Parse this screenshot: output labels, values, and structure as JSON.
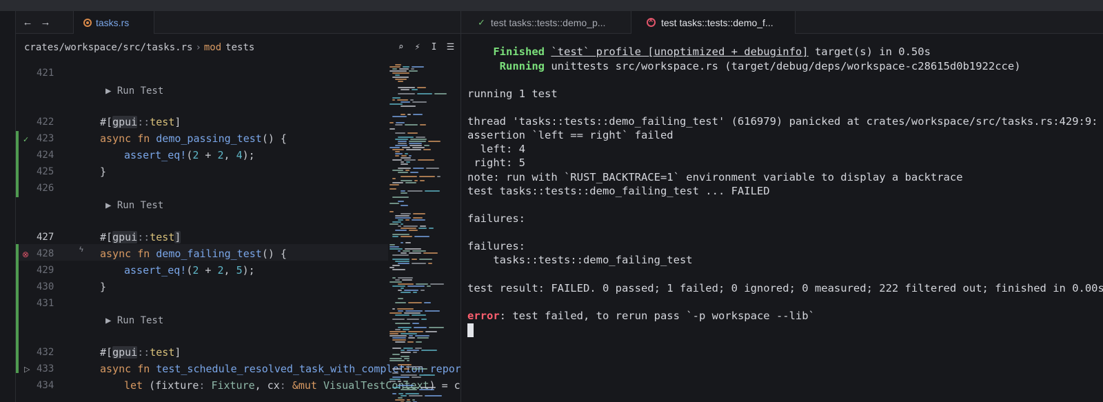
{
  "editor": {
    "active_tab": "tasks.rs",
    "breadcrumb": {
      "path": "crates/workspace/src/tasks.rs",
      "separator": "›",
      "mod_keyword": "mod",
      "mod_name": "tests"
    },
    "lines": [
      {
        "n": "421"
      },
      {
        "run": "▶ Run Test"
      },
      {
        "n": "422",
        "attr_hash": "#",
        "attr_lb": "[",
        "attr_ns": "gpui",
        "attr_sep": "::",
        "attr_name": "test",
        "attr_rb": "]"
      },
      {
        "n": "423",
        "kw1": "async",
        "kw2": "fn",
        "fn": "demo_passing_test",
        "rest": "() {"
      },
      {
        "n": "424",
        "mac": "assert_eq!",
        "args_open": "(",
        "a": "2",
        "op": " + ",
        "b": "2",
        "comma": ", ",
        "c": "4",
        "args_close": ");"
      },
      {
        "n": "425",
        "brace": "}"
      },
      {
        "n": "426"
      },
      {
        "run": "▶ Run Test"
      },
      {
        "n": "427",
        "attr_hash": "#",
        "attr_lb": "[",
        "attr_ns": "gpui",
        "attr_sep": "::",
        "attr_name": "test",
        "attr_rb": "]"
      },
      {
        "n": "428",
        "kw1": "async",
        "kw2": "fn",
        "fn": "demo_failing_test",
        "rest": "() {"
      },
      {
        "n": "429",
        "mac": "assert_eq!",
        "args_open": "(",
        "a": "2",
        "op": " + ",
        "b": "2",
        "comma": ", ",
        "c": "5",
        "args_close": ");"
      },
      {
        "n": "430",
        "brace": "}"
      },
      {
        "n": "431"
      },
      {
        "run": "▶ Run Test"
      },
      {
        "n": "432",
        "attr_hash": "#",
        "attr_lb": "[",
        "attr_ns": "gpui",
        "attr_sep": "::",
        "attr_name": "test",
        "attr_rb": "]"
      },
      {
        "n": "433",
        "kw1": "async",
        "kw2": "fn",
        "fn": "test_schedule_resolved_task_with_completion_report"
      },
      {
        "n": "434",
        "let_kw": "let",
        "let_open": " (fixture",
        "colon1": ": ",
        "ty1": "Fixture",
        "comma1": ", cx",
        "colon2": ": ",
        "ref": "&mut ",
        "ty2": "VisualTestContext",
        "tail": ") = cr"
      }
    ]
  },
  "terminal": {
    "tabs": [
      {
        "label": "test tasks::tests::demo_p...",
        "status": "passed"
      },
      {
        "label": "test tasks::tests::demo_f...",
        "status": "failed"
      }
    ],
    "output": {
      "finished_word": "Finished",
      "finished_profile": "`test` profile [unoptimized + debuginfo]",
      "finished_rest": " target(s) in 0.50s",
      "running_word": "Running",
      "running_rest": " unittests src/workspace.rs (target/debug/deps/workspace-c28615d0b1922cce)",
      "running_tests": "running 1 test",
      "panic": "thread 'tasks::tests::demo_failing_test' (616979) panicked at crates/workspace/src/tasks.rs:429:9:",
      "assertion": "assertion `left == right` failed",
      "left": "  left: 4",
      "right": " right: 5",
      "note": "note: run with `RUST_BACKTRACE=1` environment variable to display a backtrace",
      "test_failed": "test tasks::tests::demo_failing_test ... FAILED",
      "failures1": "failures:",
      "failures2": "failures:",
      "failure_name": "    tasks::tests::demo_failing_test",
      "result": "test result: FAILED. 0 passed; 1 failed; 0 ignored; 0 measured; 222 filtered out; finished in 0.00s",
      "error_word": "error",
      "error_rest": ": test failed, to rerun pass `-p workspace --lib`"
    }
  },
  "colors": {
    "accent": "#7aa6e8",
    "keyword": "#d99a62",
    "success": "#7be07b",
    "error": "#ff5f6f",
    "gutter_added": "#4f9a50"
  }
}
